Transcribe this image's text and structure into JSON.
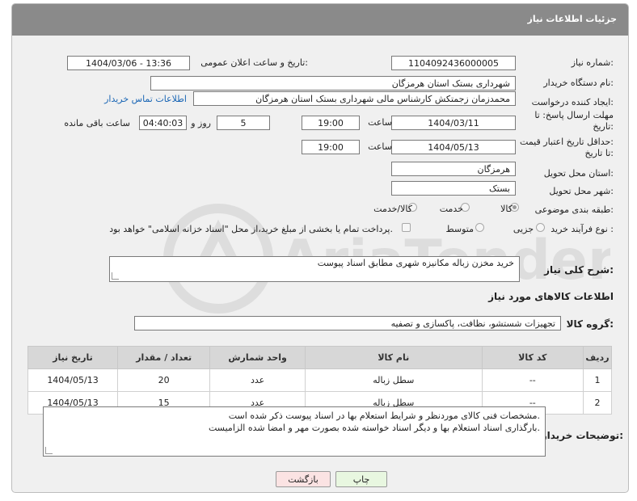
{
  "header": {
    "title": "جزئیات اطلاعات نیاز"
  },
  "fields": {
    "need_number_label": "شماره نیاز:",
    "need_number": "1104092436000005",
    "announce_label": "تاریخ و ساعت اعلان عمومی:",
    "announce_value": "1404/03/06 - 13:36",
    "buyer_label": "نام دستگاه خریدار:",
    "buyer": "شهرداری بستک استان هرمزگان",
    "requester_label": "ایجاد کننده درخواست:",
    "requester": "محمدزمان زجمتکش کارشناس مالی شهرداری بستک استان هرمزگان",
    "contact_link": "اطلاعات تماس خریدار",
    "deadline_label_1": "مهلت ارسال پاسخ: تا",
    "deadline_label_2": "تاریخ:",
    "deadline_date": "1404/03/11",
    "time_label": "ساعت",
    "deadline_time": "19:00",
    "days_value": "5",
    "days_label": "روز و",
    "remaining_time": "04:40:03",
    "remaining_label": "ساعت باقی مانده",
    "validity_label_1": "حداقل تاریخ اعتبار قیمت:",
    "validity_label_2": "تا تاریخ:",
    "validity_date": "1404/05/13",
    "validity_time": "19:00",
    "province_label": "استان محل تحویل:",
    "province": "هرمزگان",
    "city_label": "شهر محل تحویل:",
    "city": "بستک",
    "category_label": "طبقه بندی موضوعی:",
    "category_options": [
      "کالا",
      "خدمت",
      "کالا/خدمت"
    ],
    "category_selected": "کالا",
    "process_label": "نوع فرآیند خرید :",
    "process_options": [
      "جزیی",
      "متوسط"
    ],
    "payment_note": "پرداخت تمام یا بخشی از مبلغ خرید،از محل \"اسناد خزانه اسلامی\" خواهد بود."
  },
  "description": {
    "label": "شرح کلی نیاز:",
    "value": "خرید مخزن زباله مکانیزه شهری مطابق اسناد پیوست"
  },
  "goods": {
    "section_title": "اطلاعات کالاهای مورد نیاز",
    "group_label": "گروه کالا:",
    "group_value": "تجهیزات شستشو، نظافت، پاکسازی و تصفیه"
  },
  "table": {
    "headers": [
      "ردیف",
      "کد کالا",
      "نام کالا",
      "واحد شمارش",
      "تعداد / مقدار",
      "تاریخ نیاز"
    ],
    "rows": [
      [
        "1",
        "--",
        "سطل زباله",
        "عدد",
        "20",
        "1404/05/13"
      ],
      [
        "2",
        "--",
        "سطل زباله",
        "عدد",
        "15",
        "1404/05/13"
      ]
    ]
  },
  "buyer_notes": {
    "label": "توضیحات خریدار:",
    "line1": "مشخصات فنی کالای موردنظر و شرایط استعلام بها در اسناد پیوست ذکر شده است.",
    "line2": "بارگذاری اسناد استعلام بها و دیگر اسناد خواسته شده بصورت مهر و امضا شده الزامیست."
  },
  "buttons": {
    "print": "چاپ",
    "back": "بازگشت"
  },
  "watermark": {
    "text": "AriaTender.net"
  },
  "colors": {
    "title_bar": "#8a8a8a",
    "link": "#1a66b5",
    "print_bg": "#e8f7e0",
    "back_bg": "#fbe3e3"
  }
}
